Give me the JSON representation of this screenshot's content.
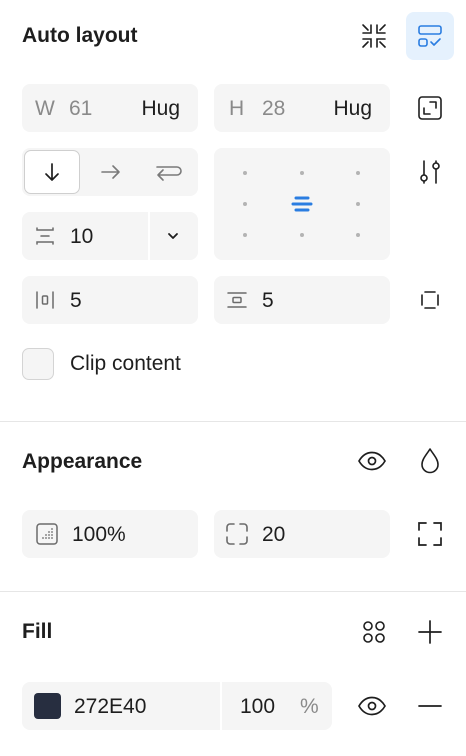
{
  "auto_layout": {
    "title": "Auto layout",
    "width": {
      "label": "W",
      "value": "61",
      "mode": "Hug"
    },
    "height": {
      "label": "H",
      "value": "28",
      "mode": "Hug"
    },
    "gap": "10",
    "padding_horizontal": "5",
    "padding_vertical": "5",
    "clip_content_label": "Clip content",
    "accent_color": "#2a7de1"
  },
  "appearance": {
    "title": "Appearance",
    "opacity": "100%",
    "corner_radius": "20"
  },
  "fill": {
    "title": "Fill",
    "color_hex": "272E40",
    "swatch_color": "#272E40",
    "opacity": "100",
    "percent_sign": "%"
  }
}
